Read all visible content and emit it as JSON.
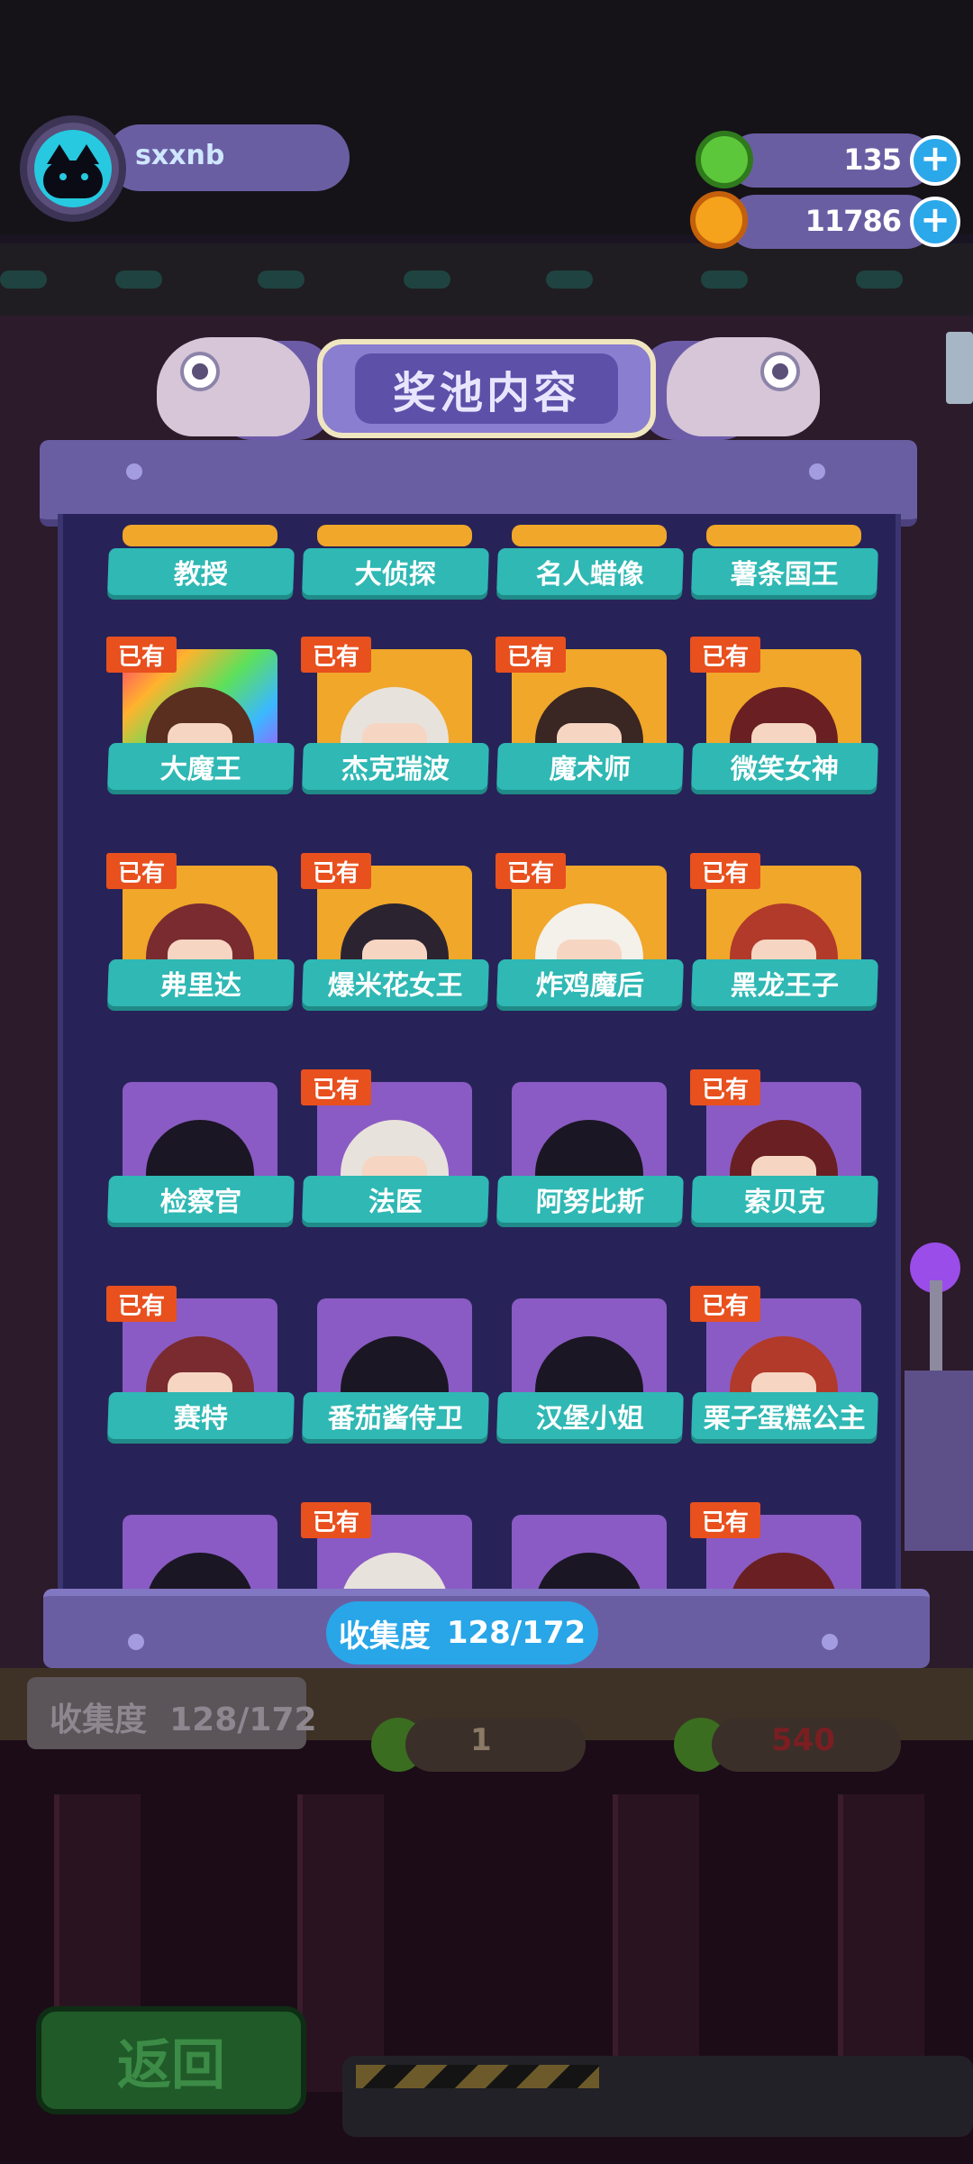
{
  "profile": {
    "username": "sxxnb"
  },
  "resources": [
    {
      "name": "green-coin",
      "value": "135",
      "color": "#5cc73a"
    },
    {
      "name": "orange-planet",
      "value": "11786",
      "color": "#f5a21c"
    }
  ],
  "modal": {
    "title": "奖池内容",
    "collection_label": "收集度",
    "collection_value": "128/172",
    "owned_badge": "已有",
    "rows": [
      {
        "partial": true,
        "items": [
          {
            "name": "教授",
            "owned": false,
            "style": "gold"
          },
          {
            "name": "大侦探",
            "owned": false,
            "style": "gold"
          },
          {
            "name": "名人蜡像",
            "owned": false,
            "style": "gold"
          },
          {
            "name": "薯条国王",
            "owned": false,
            "style": "gold"
          }
        ]
      },
      {
        "items": [
          {
            "name": "大魔王",
            "owned": true,
            "style": "rainbow"
          },
          {
            "name": "杰克瑞波",
            "owned": true,
            "style": "gold"
          },
          {
            "name": "魔术师",
            "owned": true,
            "style": "gold"
          },
          {
            "name": "微笑女神",
            "owned": true,
            "style": "gold"
          }
        ]
      },
      {
        "items": [
          {
            "name": "弗里达",
            "owned": true,
            "style": "gold"
          },
          {
            "name": "爆米花女王",
            "owned": true,
            "style": "gold"
          },
          {
            "name": "炸鸡魔后",
            "owned": true,
            "style": "gold"
          },
          {
            "name": "黑龙王子",
            "owned": true,
            "style": "gold"
          }
        ]
      },
      {
        "items": [
          {
            "name": "检察官",
            "owned": false,
            "style": "purple"
          },
          {
            "name": "法医",
            "owned": true,
            "style": "purple"
          },
          {
            "name": "阿努比斯",
            "owned": false,
            "style": "purple"
          },
          {
            "name": "索贝克",
            "owned": true,
            "style": "purple"
          }
        ]
      },
      {
        "items": [
          {
            "name": "赛特",
            "owned": true,
            "style": "purple"
          },
          {
            "name": "番茄酱侍卫",
            "owned": false,
            "style": "purple"
          },
          {
            "name": "汉堡小姐",
            "owned": false,
            "style": "purple"
          },
          {
            "name": "栗子蛋糕公主",
            "owned": true,
            "style": "purple"
          }
        ]
      },
      {
        "items": [
          {
            "name": "",
            "owned": false,
            "style": "purple"
          },
          {
            "name": "",
            "owned": true,
            "style": "purple"
          },
          {
            "name": "",
            "owned": false,
            "style": "purple"
          },
          {
            "name": "",
            "owned": true,
            "style": "purple"
          }
        ]
      }
    ]
  },
  "background": {
    "collection_label": "收集度",
    "collection_value": "128/172",
    "counter_left": "1",
    "counter_right": "540"
  },
  "buttons": {
    "back_label": "返回"
  }
}
